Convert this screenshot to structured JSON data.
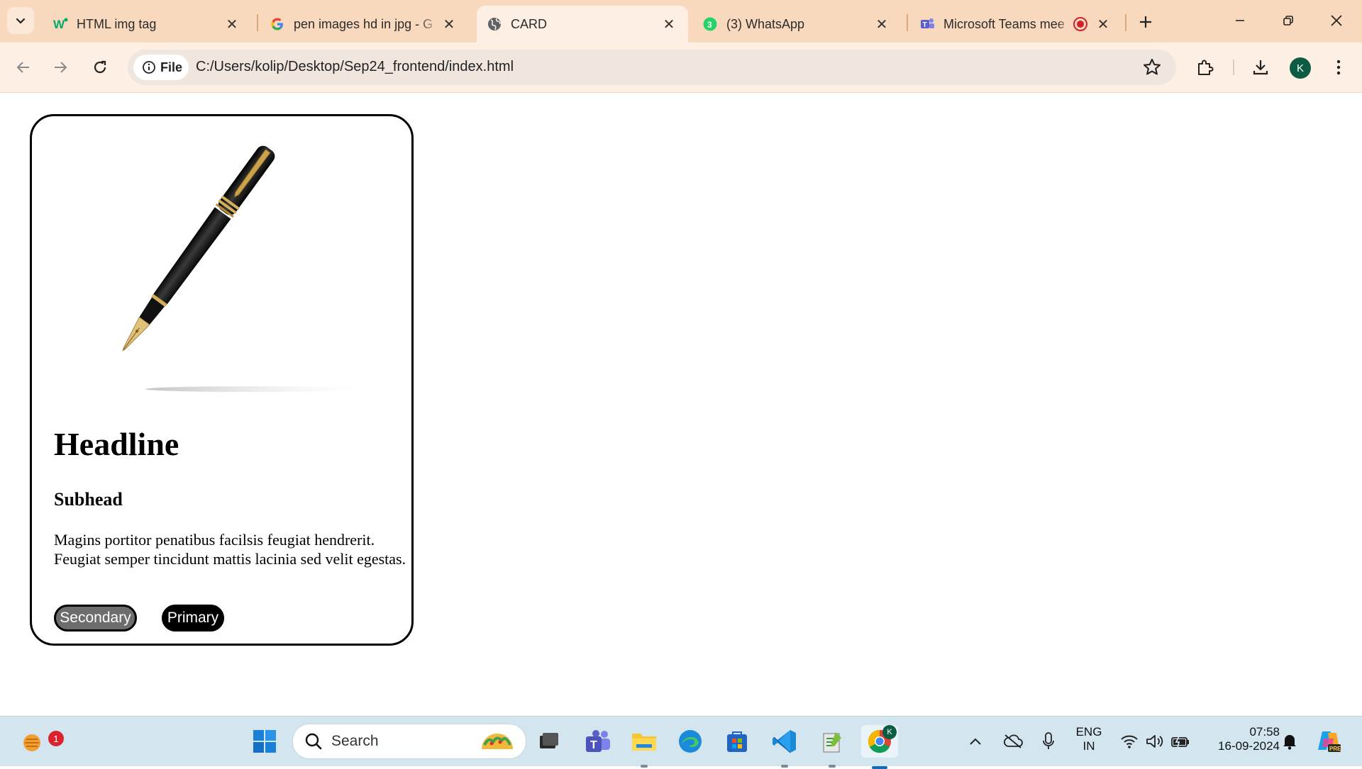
{
  "browser": {
    "tabs": [
      {
        "title": "HTML img tag",
        "icon": "w3schools-icon",
        "active": false
      },
      {
        "title": "pen images hd in jpg - G",
        "icon": "google-icon",
        "active": false
      },
      {
        "title": "CARD",
        "icon": "globe-icon",
        "active": true
      },
      {
        "title": "(3) WhatsApp",
        "icon": "whatsapp-icon",
        "active": false
      },
      {
        "title": "Microsoft Teams mee",
        "icon": "teams-icon",
        "active": false
      }
    ],
    "file_chip": "File",
    "url": "C:/Users/kolip/Desktop/Sep24_frontend/index.html",
    "avatar_letter": "K",
    "colors": {
      "tabstrip": "#f9d9bd",
      "toolbar": "#fdefe4"
    }
  },
  "card": {
    "headline": "Headline",
    "subhead": "Subhead",
    "body": "Magins portitor penatibus facilsis feugiat hendrerit. Feugiat semper tincidunt mattis lacinia sed velit egestas.",
    "secondary_label": "Secondary",
    "primary_label": "Primary",
    "image": "fountain-pen-image"
  },
  "taskbar": {
    "widget_badge": "1",
    "search_label": "Search",
    "lang_line1": "ENG",
    "lang_line2": "IN",
    "time": "07:58",
    "date": "16-09-2024",
    "chrome_profile_letter": "K"
  }
}
